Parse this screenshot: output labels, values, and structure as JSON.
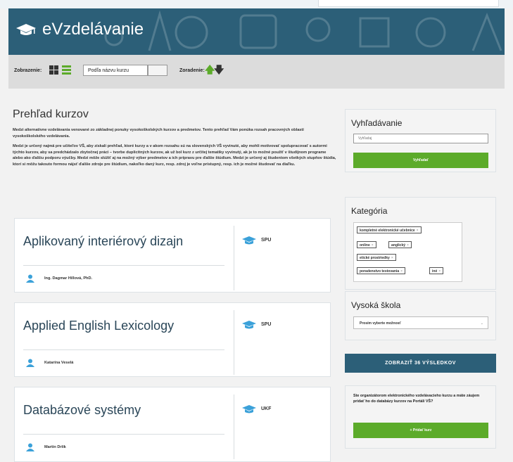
{
  "header": {
    "app_title": "eVzdelávanie"
  },
  "toolbar": {
    "view_label": "Zobrazenie:",
    "sort_select_value": "Podľa názvu kurzu",
    "sort_label": "Zoradenie:"
  },
  "main": {
    "title": "Prehľad kurzov",
    "intro_p1": "Medzi alternatívne vzdelávania venované zo základnej ponuky vysokoškolských kurzov a predmetov. Tento prehľad Vám ponúka rozsah pracovných oblastí vysokoškolského vzdelávania.",
    "intro_p2": "Medzi je určený najmä pre učiteľov VŠ, aby získali prehľad, ktoré kurzy a v akom rozsahu sú na slovenských VŠ vyvinuté, aby mohli motivovať spolupracovať s autormi týchto kurzov, aby sa predchádzalo zbytočnej práci – tvorbe duplicitných kurzov, ak už bol kurz z určitej tematiky vyvinutý, ak je to možné použiť v študijnom programe alebo ako ďalšiu podporu výučby. Medzi môže slúžiť aj na možný výber predmetov a ich prípravu pre ďalšie štúdium. Medzi je určený aj študentom všetkých stupňov štúdia, ktorí si môžu takouto formou nájsť ďalšie zdroje pre štúdium, nakoľko daný kurz, resp. zdroj je voľne prístupný, resp. ich je možné študovať na diaľku."
  },
  "courses": [
    {
      "title": "Aplikovaný interiérový dizajn",
      "person": "Ing. Dagmar Hillová, PhD.",
      "school": "SPU"
    },
    {
      "title": "Applied English Lexicology",
      "person": "Katarína Veselá",
      "school": "SPU"
    },
    {
      "title": "Databázové systémy",
      "person": "Martin Drlík",
      "school": "UKF"
    }
  ],
  "sidebar": {
    "search": {
      "heading": "Vyhľadávanie",
      "placeholder": "Vyhľadaj",
      "button": "Vyhľadať"
    },
    "category": {
      "heading": "Kategória",
      "tags": [
        "kompletné elektronické učebnice",
        "online",
        "anglický",
        "etické prostriedky",
        "poradenstvo testovania",
        "iné"
      ]
    },
    "school": {
      "heading": "Vysoká škola",
      "select_value": "Prosím vyberte možnosť"
    },
    "results_button": "ZOBRAZIŤ 36 VÝSLEDKOV",
    "promo": {
      "text": "Ste organizátorom elektronického vzdelávacieho kurzu a máte záujem pridať ho do databázy kurzov na Portáli VŠ?",
      "button": "Pridať kurz"
    }
  },
  "colors": {
    "header": "#2c5f78",
    "accent_green": "#5cab2a",
    "title_text": "#2a4658"
  }
}
